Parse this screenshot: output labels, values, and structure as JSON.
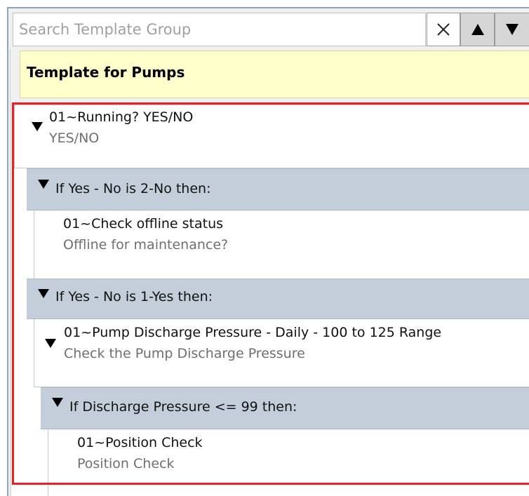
{
  "search": {
    "placeholder": "Search Template Group",
    "clear_symbol": "✕",
    "up_symbol": "▲",
    "down_symbol": "▼"
  },
  "template": {
    "title": "Template for Pumps"
  },
  "items": {
    "q1": {
      "title": "01~Running? YES/NO",
      "subtitle": "YES/NO"
    },
    "cond1": {
      "label": "If Yes - No is 2-No then:"
    },
    "q2": {
      "title": "01~Check offline status",
      "subtitle": "Offline for maintenance?"
    },
    "cond2": {
      "label": "If Yes - No is 1-Yes then:"
    },
    "q3": {
      "title": "01~Pump Discharge Pressure - Daily - 100 to 125 Range",
      "subtitle": "Check the Pump Discharge Pressure"
    },
    "cond3": {
      "label": "If Discharge Pressure <= 99 then:"
    },
    "q4": {
      "title": "01~Position Check",
      "subtitle": "Position Check"
    }
  },
  "colors": {
    "selection": "#e8202a",
    "template_header_bg": "#ffffcc",
    "condition_bg": "#c4ceda"
  },
  "icons": {
    "expand": "triangle-down-icon"
  }
}
